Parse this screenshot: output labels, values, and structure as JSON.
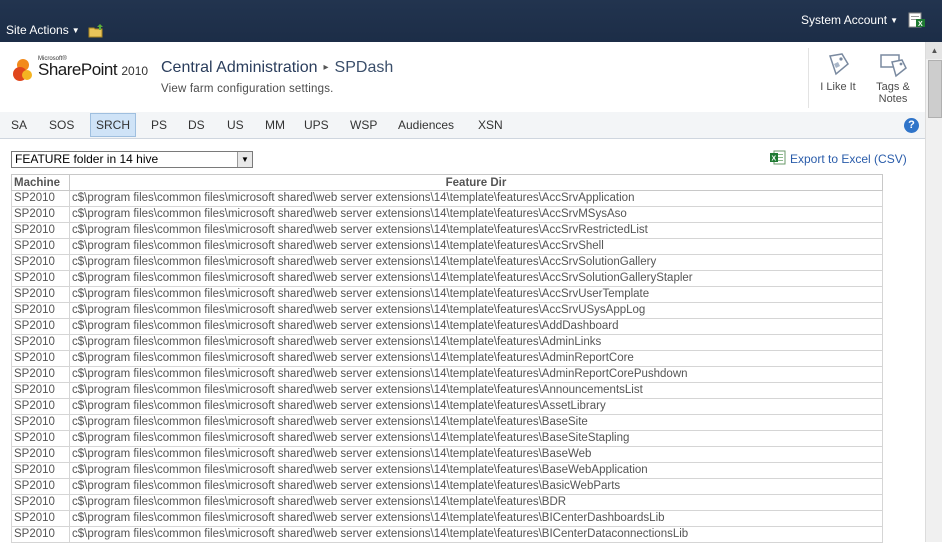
{
  "topbar": {
    "site_actions": "Site Actions",
    "account": "System Account"
  },
  "header": {
    "logo_small": "Microsoft®",
    "logo_brand": "SharePoint",
    "logo_year": "2010",
    "breadcrumb_root": "Central Administration",
    "breadcrumb_separator": "▸",
    "breadcrumb_current": "SPDash",
    "description": "View farm configuration settings.",
    "like_label": "I Like It",
    "tags_label_1": "Tags &",
    "tags_label_2": "Notes"
  },
  "tabs": [
    {
      "label": "SA"
    },
    {
      "label": "SOS"
    },
    {
      "label": "SRCH"
    },
    {
      "label": "PS"
    },
    {
      "label": "DS"
    },
    {
      "label": "US"
    },
    {
      "label": "MM"
    },
    {
      "label": "UPS"
    },
    {
      "label": "WSP"
    },
    {
      "label": "Audiences"
    },
    {
      "label": "XSN"
    }
  ],
  "active_tab": "SRCH",
  "help_label": "?",
  "report_select": {
    "value": "FEATURE folder in 14 hive"
  },
  "export_label": "Export to Excel (CSV)",
  "table": {
    "headers": [
      "Machine",
      "Feature Dir"
    ],
    "rows": [
      [
        "SP2010",
        "c$\\program files\\common files\\microsoft shared\\web server extensions\\14\\template\\features\\AccSrvApplication"
      ],
      [
        "SP2010",
        "c$\\program files\\common files\\microsoft shared\\web server extensions\\14\\template\\features\\AccSrvMSysAso"
      ],
      [
        "SP2010",
        "c$\\program files\\common files\\microsoft shared\\web server extensions\\14\\template\\features\\AccSrvRestrictedList"
      ],
      [
        "SP2010",
        "c$\\program files\\common files\\microsoft shared\\web server extensions\\14\\template\\features\\AccSrvShell"
      ],
      [
        "SP2010",
        "c$\\program files\\common files\\microsoft shared\\web server extensions\\14\\template\\features\\AccSrvSolutionGallery"
      ],
      [
        "SP2010",
        "c$\\program files\\common files\\microsoft shared\\web server extensions\\14\\template\\features\\AccSrvSolutionGalleryStapler"
      ],
      [
        "SP2010",
        "c$\\program files\\common files\\microsoft shared\\web server extensions\\14\\template\\features\\AccSrvUserTemplate"
      ],
      [
        "SP2010",
        "c$\\program files\\common files\\microsoft shared\\web server extensions\\14\\template\\features\\AccSrvUSysAppLog"
      ],
      [
        "SP2010",
        "c$\\program files\\common files\\microsoft shared\\web server extensions\\14\\template\\features\\AddDashboard"
      ],
      [
        "SP2010",
        "c$\\program files\\common files\\microsoft shared\\web server extensions\\14\\template\\features\\AdminLinks"
      ],
      [
        "SP2010",
        "c$\\program files\\common files\\microsoft shared\\web server extensions\\14\\template\\features\\AdminReportCore"
      ],
      [
        "SP2010",
        "c$\\program files\\common files\\microsoft shared\\web server extensions\\14\\template\\features\\AdminReportCorePushdown"
      ],
      [
        "SP2010",
        "c$\\program files\\common files\\microsoft shared\\web server extensions\\14\\template\\features\\AnnouncementsList"
      ],
      [
        "SP2010",
        "c$\\program files\\common files\\microsoft shared\\web server extensions\\14\\template\\features\\AssetLibrary"
      ],
      [
        "SP2010",
        "c$\\program files\\common files\\microsoft shared\\web server extensions\\14\\template\\features\\BaseSite"
      ],
      [
        "SP2010",
        "c$\\program files\\common files\\microsoft shared\\web server extensions\\14\\template\\features\\BaseSiteStapling"
      ],
      [
        "SP2010",
        "c$\\program files\\common files\\microsoft shared\\web server extensions\\14\\template\\features\\BaseWeb"
      ],
      [
        "SP2010",
        "c$\\program files\\common files\\microsoft shared\\web server extensions\\14\\template\\features\\BaseWebApplication"
      ],
      [
        "SP2010",
        "c$\\program files\\common files\\microsoft shared\\web server extensions\\14\\template\\features\\BasicWebParts"
      ],
      [
        "SP2010",
        "c$\\program files\\common files\\microsoft shared\\web server extensions\\14\\template\\features\\BDR"
      ],
      [
        "SP2010",
        "c$\\program files\\common files\\microsoft shared\\web server extensions\\14\\template\\features\\BICenterDashboardsLib"
      ],
      [
        "SP2010",
        "c$\\program files\\common files\\microsoft shared\\web server extensions\\14\\template\\features\\BICenterDataconnectionsLib"
      ]
    ]
  }
}
